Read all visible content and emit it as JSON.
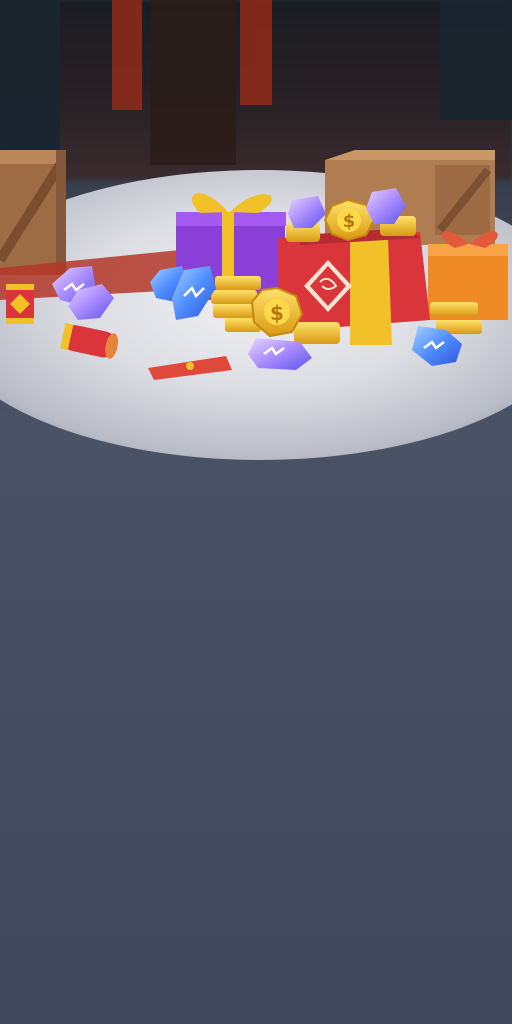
{
  "scene": {
    "kind": "game-loading-background",
    "theme": "lunar-new-year-rewards",
    "colors": {
      "backdrop_dark": "#1d1c22",
      "floor_spotlight": "#e6e7ec",
      "floor_shadow": "#3f475b",
      "gift_red": "#d9353a",
      "gift_purple": "#8a3fd6",
      "gift_orange": "#ef8a24",
      "ribbon_gold": "#f2c12a",
      "gem_blue": "#5aa8ff",
      "gem_violet": "#b78cff",
      "crate_wood": "#a9754d"
    },
    "objects": [
      {
        "name": "left-wooden-crate-icon"
      },
      {
        "name": "right-wooden-crate-icon"
      },
      {
        "name": "purple-gift-box-icon"
      },
      {
        "name": "red-gift-box-icon"
      },
      {
        "name": "orange-gift-box-icon"
      },
      {
        "name": "gold-coin-icon"
      },
      {
        "name": "gem-icon"
      },
      {
        "name": "firecracker-icon"
      },
      {
        "name": "red-envelope-icon"
      }
    ]
  }
}
